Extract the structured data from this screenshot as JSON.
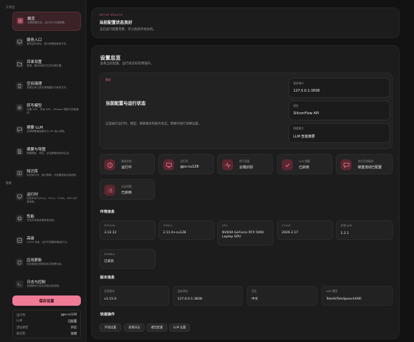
{
  "sidebar": {
    "section_workspace": "工作台",
    "section_system": "系统",
    "items": [
      {
        "title": "概览",
        "desc": "查看配置状态、运行时与关键配置。",
        "icon": "grid-icon"
      },
      {
        "title": "服务入口",
        "desc": "服务监听地址、端口和基础服务开关。",
        "icon": "monitor-icon"
      },
      {
        "title": "目录设置",
        "desc": "数据、缓存和临时文件存储位置。",
        "icon": "folder-icon"
      },
      {
        "title": "空间清理",
        "desc": "查看空间占用并清理缓存与临时文件。",
        "icon": "trash-icon"
      },
      {
        "title": "转写模型",
        "desc": "设置 ASR、本地 ASR、Whisper 模型与设备偏好。",
        "icon": "gear-icon"
      },
      {
        "title": "摘要 LLM",
        "desc": "选择摘要模型服务与 API 接入参数。",
        "icon": "chat-icon"
      },
      {
        "title": "摘要与导图",
        "desc": "摘要模板、语言、总结策略和结构生成。",
        "icon": "document-icon"
      },
      {
        "title": "知识库",
        "desc": "知识库开关、索引策略、问答模型和检索参数。",
        "icon": "book-icon"
      },
      {
        "title": "运行时",
        "desc": "检查本地 Python、Torch、CUDA、ASR 与扩展依赖。",
        "icon": "runtime-icon"
      },
      {
        "title": "性能",
        "desc": "任务并发和资源使用控制。",
        "icon": "chip-icon"
      },
      {
        "title": "高级",
        "desc": "CUDA 安装、运行时调整和高级行为。",
        "icon": "advanced-icon"
      },
      {
        "title": "应用更新",
        "desc": "检查桌面应用新版本并管理安装。",
        "icon": "update-icon"
      },
      {
        "title": "日志与控制",
        "desc": "查看服务日志并控制后端进程。",
        "icon": "terminal-icon"
      }
    ],
    "save_label": "保存设置",
    "status": [
      {
        "k": "运行时",
        "v": "gpu-cu128"
      },
      {
        "k": "LLM",
        "v": "已配置"
      },
      {
        "k": "流动讲堂",
        "v": "开启"
      },
      {
        "k": "知识库",
        "v": "就绪"
      }
    ]
  },
  "health": {
    "eyebrow": "SETUP HEALTH",
    "title": "当前配置状态良好",
    "desc": "当前运行配置完整，可以直接开始总结。"
  },
  "overview": {
    "title": "设置总览",
    "subtitle": "查看当前配置、运行状态和常用操作。",
    "hero": {
      "badge": "概览",
      "title": "当前配置与运行状态",
      "desc": "这里展示运行时、模型、摘要模式和服务状态。需要时进行详细设置。",
      "fields": [
        {
          "label": "服务端口",
          "value": "127.0.0.1:3838"
        },
        {
          "label": "模型",
          "value": "SiliconFlow API"
        },
        {
          "label": "摘要模式",
          "value": "LLM 智能摘要"
        }
      ]
    },
    "tiles": [
      {
        "label": "服务状态",
        "value": "运行中",
        "icon": "clock-icon"
      },
      {
        "label": "运行时",
        "value": "gpu-cu128",
        "icon": "monitor-icon"
      },
      {
        "label": "转写设备",
        "value": "云端识别",
        "icon": "activity-icon"
      },
      {
        "label": "LLM 摘要",
        "value": "已启用",
        "icon": "check-icon"
      },
      {
        "label": "流式识别服务",
        "value": "链基流动已配置",
        "icon": "chat-icon"
      },
      {
        "label": "自动导图",
        "value": "已启用",
        "icon": "list-icon"
      }
    ],
    "env_title": "环境信息",
    "env": [
      {
        "label": "PYTHON",
        "value": "3.12.12"
      },
      {
        "label": "TORCH",
        "value": "2.11.0+cu128"
      },
      {
        "label": "GPU",
        "value": "NVIDIA GeForce RTX 5060 Laptop GPU"
      },
      {
        "label": "YT-DLP",
        "value": "2026.3.17"
      },
      {
        "label": "本地 ASR",
        "value": "1.2.1"
      },
      {
        "label": "FFMPEG",
        "value": "已安装"
      }
    ],
    "version_title": "版本信息",
    "version": [
      {
        "label": "应用版本",
        "value": "v1.15.0"
      },
      {
        "label": "监听地址",
        "value": "127.0.0.1:3838"
      },
      {
        "label": "语言",
        "value": "中文"
      },
      {
        "label": "ASR 模型",
        "value": "TeleAI/TeleSpeechASR"
      }
    ],
    "quick_title": "快速操作",
    "quick": [
      "环境设置",
      "查看日志",
      "模型配置",
      "LLM 设置"
    ]
  },
  "colors": {
    "accent": "#f07b97",
    "accent_dark": "#5a2730",
    "bg": "#121212",
    "card": "#1c1c1c"
  }
}
